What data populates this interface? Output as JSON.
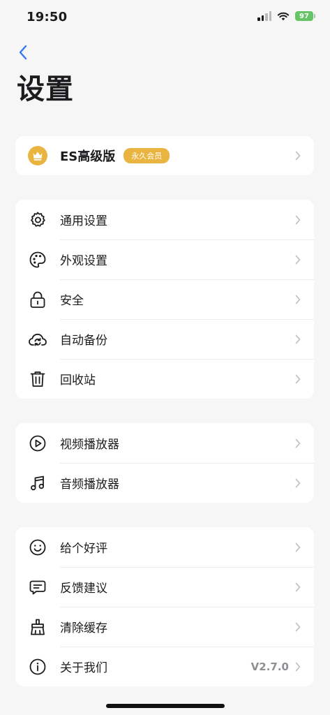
{
  "status_bar": {
    "time": "19:50",
    "battery": "97"
  },
  "header": {
    "title": "设置"
  },
  "premium": {
    "label": "ES高级版",
    "badge": "永久会员",
    "icon": "crown-icon"
  },
  "groups": [
    {
      "items": [
        {
          "label": "通用设置",
          "icon": "gear-icon"
        },
        {
          "label": "外观设置",
          "icon": "palette-icon"
        },
        {
          "label": "安全",
          "icon": "lock-icon"
        },
        {
          "label": "自动备份",
          "icon": "cloud-sync-icon"
        },
        {
          "label": "回收站",
          "icon": "trash-icon"
        }
      ]
    },
    {
      "items": [
        {
          "label": "视频播放器",
          "icon": "play-circle-icon"
        },
        {
          "label": "音频播放器",
          "icon": "music-note-icon"
        }
      ]
    },
    {
      "items": [
        {
          "label": "给个好评",
          "icon": "smile-icon"
        },
        {
          "label": "反馈建议",
          "icon": "message-icon"
        },
        {
          "label": "清除缓存",
          "icon": "broom-icon"
        },
        {
          "label": "关于我们",
          "icon": "info-icon",
          "value": "V2.7.0"
        }
      ]
    }
  ],
  "colors": {
    "accent": "#3478f6",
    "gold": "#e9b43f",
    "background": "#f6f6f7"
  }
}
